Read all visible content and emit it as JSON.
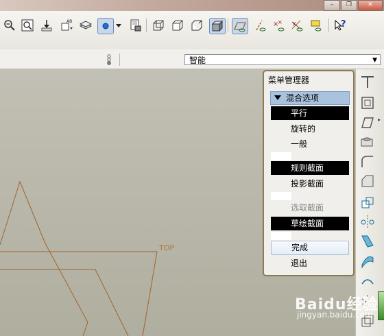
{
  "window": {
    "minimize": "–",
    "restore": "❐",
    "close": "✕"
  },
  "toolbar": {
    "help_label": "?"
  },
  "filter": {
    "value": "智能"
  },
  "canvas": {
    "datum_label": "TOP"
  },
  "menu": {
    "title": "菜单管理器",
    "header": "混合选项",
    "items": [
      {
        "label": "平行",
        "state": "selected"
      },
      {
        "label": "旋转的",
        "state": "normal"
      },
      {
        "label": "一般",
        "state": "normal"
      },
      {
        "label": "规则截面",
        "state": "selected"
      },
      {
        "label": "投影截面",
        "state": "normal"
      },
      {
        "label": "选取截面",
        "state": "disabled"
      },
      {
        "label": "草绘截面",
        "state": "selected"
      }
    ],
    "done": "完成",
    "quit": "退出"
  },
  "watermark": {
    "brand": "Baidu经验",
    "url": "jingyan.baidu.com"
  },
  "colors": {
    "accent": "#a9c2dd",
    "menu_border": "#8b7b55",
    "sketch": "#b07a3a"
  }
}
